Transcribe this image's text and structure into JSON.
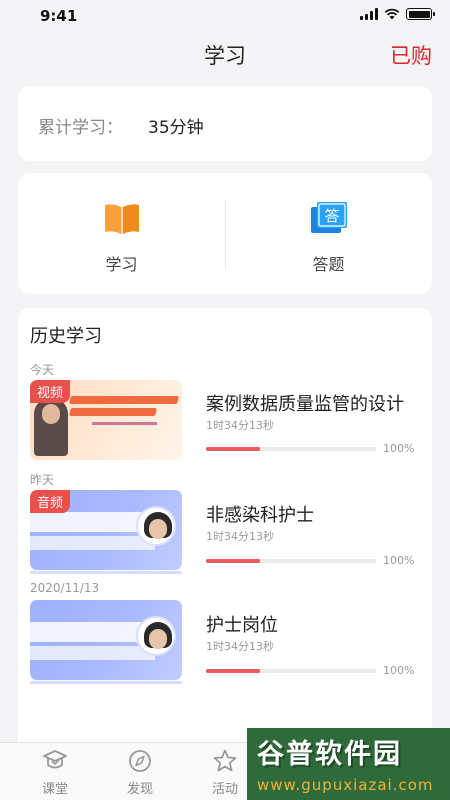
{
  "status_bar": {
    "time": "9:41"
  },
  "header": {
    "title": "学习",
    "action": "已购"
  },
  "summary": {
    "label": "累计学习：",
    "value": "35分钟"
  },
  "entries": [
    {
      "label": "学习",
      "icon": "book-icon"
    },
    {
      "label": "答题",
      "icon": "quiz-icon"
    }
  ],
  "history": {
    "title": "历史学习",
    "groups": [
      {
        "date": "今天",
        "item": {
          "badge": "视频",
          "title": "案例数据质量监管的设计",
          "duration": "1时34分13秒",
          "progress": 0.32,
          "progress_text": "100%"
        }
      },
      {
        "date": "昨天",
        "item": {
          "badge": "音频",
          "title": "非感染科护士",
          "duration": "1时34分13秒",
          "progress": 0.32,
          "progress_text": "100%"
        }
      },
      {
        "date": "2020/11/13",
        "item": {
          "badge": "",
          "title": "护士岗位",
          "duration": "1时34分13秒",
          "progress": 0.32,
          "progress_text": "100%"
        }
      }
    ]
  },
  "tabbar": [
    {
      "label": "课堂",
      "icon": "classroom-icon"
    },
    {
      "label": "发现",
      "icon": "compass-icon"
    },
    {
      "label": "活动",
      "icon": "star-icon"
    }
  ],
  "watermark": {
    "main": "谷普软件园",
    "url": "www.gupuxiazai.com"
  },
  "colors": {
    "accent": "#d7282f",
    "progress": "#e9585c",
    "badge": "#e8504c"
  }
}
